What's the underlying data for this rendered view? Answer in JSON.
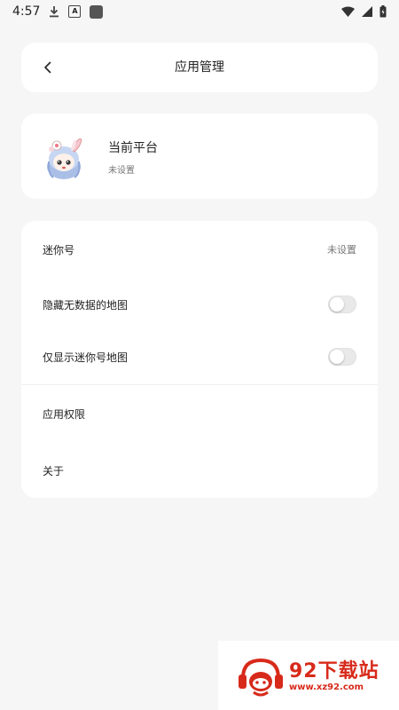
{
  "status_bar": {
    "time": "4:57",
    "icons": [
      "download-icon",
      "a-icon",
      "square-icon",
      "wifi-icon",
      "signal-icon",
      "battery-icon"
    ]
  },
  "header": {
    "title": "应用管理",
    "back_icon": "chevron-left-icon"
  },
  "platform": {
    "title": "当前平台",
    "subtitle": "未设置"
  },
  "settings": {
    "mini_id": {
      "label": "迷你号",
      "value": "未设置"
    },
    "hide_empty_maps": {
      "label": "隐藏无数据的地图",
      "on": false
    },
    "only_mini_maps": {
      "label": "仅显示迷你号地图",
      "on": false
    },
    "app_permissions": {
      "label": "应用权限"
    },
    "about": {
      "label": "关于"
    }
  },
  "watermark": {
    "main": "92下载站",
    "url": "www.xz92.com"
  },
  "colors": {
    "background": "#f6f6f6",
    "card": "#ffffff",
    "watermark": "#d72a1a"
  }
}
